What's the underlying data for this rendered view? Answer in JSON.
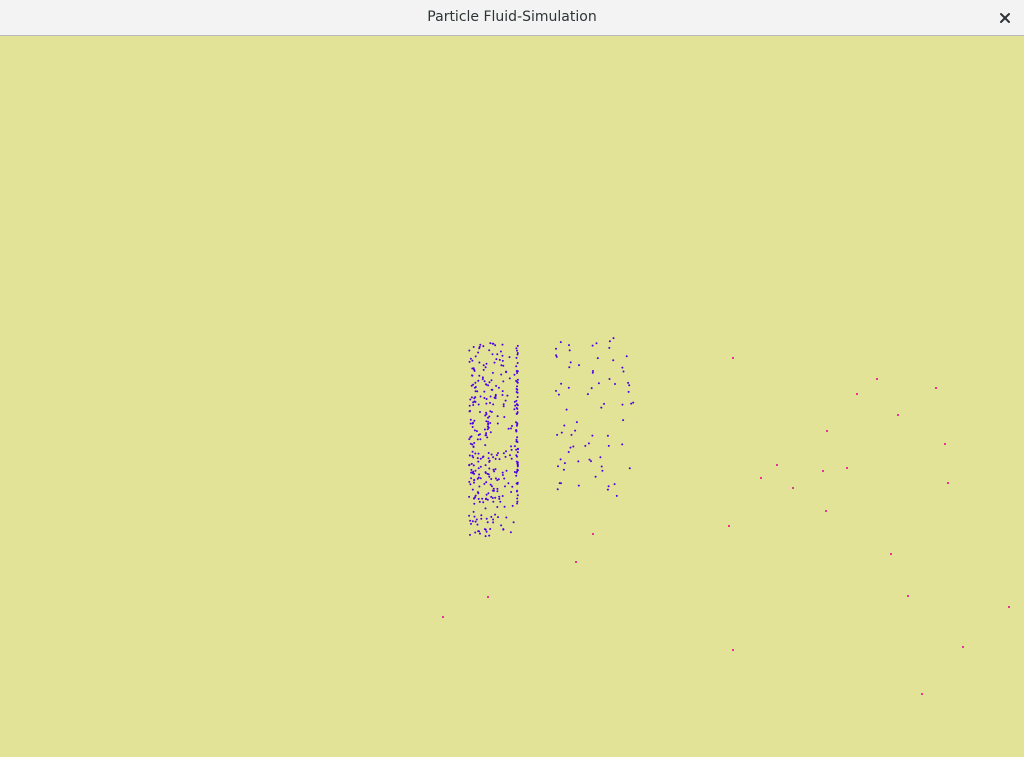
{
  "window": {
    "title": "Particle Fluid-Simulation",
    "close_icon": "close-icon"
  },
  "simulation": {
    "background_color": "#e3e397",
    "fluid_particle_color": "#4b00e6",
    "fast_particle_color": "#e0009a"
  }
}
